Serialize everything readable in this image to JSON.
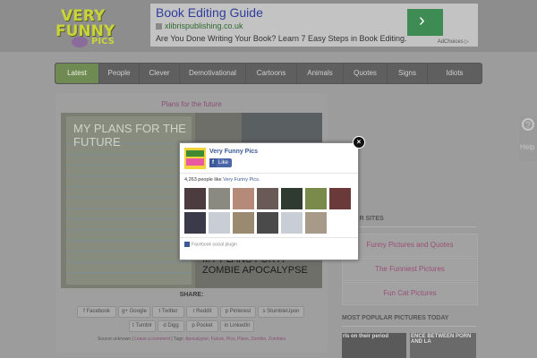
{
  "header": {
    "logo_line1": "VERY",
    "logo_line2": "FUNNY",
    "logo_line3": "PICS"
  },
  "ad": {
    "title": "Book Editing Guide",
    "url": "xlibrispublishing.co.uk",
    "text": "Are You Done Writing Your Book? Learn 7 Easy Steps in Book Editing.",
    "button": "›",
    "choices": "AdChoices ▷"
  },
  "nav": {
    "items": [
      "Latest",
      "People",
      "Clever",
      "Demotivational",
      "Cartoons",
      "Animals",
      "Quotes",
      "Signs",
      "Idiots"
    ]
  },
  "post": {
    "title": "Plans for the future",
    "image_left_text": "MY PLANS FOR THE FUTURE",
    "image_right_text": "MY PLANS FOR A ZOMBIE APOCALYPSE",
    "share_label": "SHARE:",
    "share_row1": [
      "Facebook",
      "Google",
      "Twitter",
      "Reddit",
      "Pinterest",
      "StumbleUpon"
    ],
    "share_row2": [
      "Tumblr",
      "Digg",
      "Pocket",
      "LinkedIn"
    ],
    "meta_prefix": "Source unknown |",
    "meta_comment": "Leave a comment",
    "meta_tags_label": "| Tags:",
    "meta_tags": "Apocalypse, Future, Pics, Plans, Zombie, Zombies"
  },
  "sidebar": {
    "other_sites_heading": "OTHER SITES",
    "links": [
      "Funny Pictures and Quotes",
      "The Funniest Pictures",
      "Fun Cat Pictures"
    ],
    "popular_heading": "MOST POPULAR PICTURES TODAY",
    "thumb1": "rls on their period",
    "thumb2": "ENCE BETWEEN PORN AND LA"
  },
  "help_tab": {
    "icon": "?",
    "label": "Help"
  },
  "fb_popup": {
    "close": "×",
    "page_name": "Very Funny Pics",
    "like_button": "Like",
    "count_prefix": "4,263 people like",
    "count_link": "Very Funny Pics",
    "count_suffix": ".",
    "footer": "Facebook social plugin"
  },
  "colors": {
    "accent_pink": "#8a4f74",
    "nav_active": "#6f8a52",
    "facebook_blue": "#3b5998",
    "ad_button": "#3e8c53"
  }
}
